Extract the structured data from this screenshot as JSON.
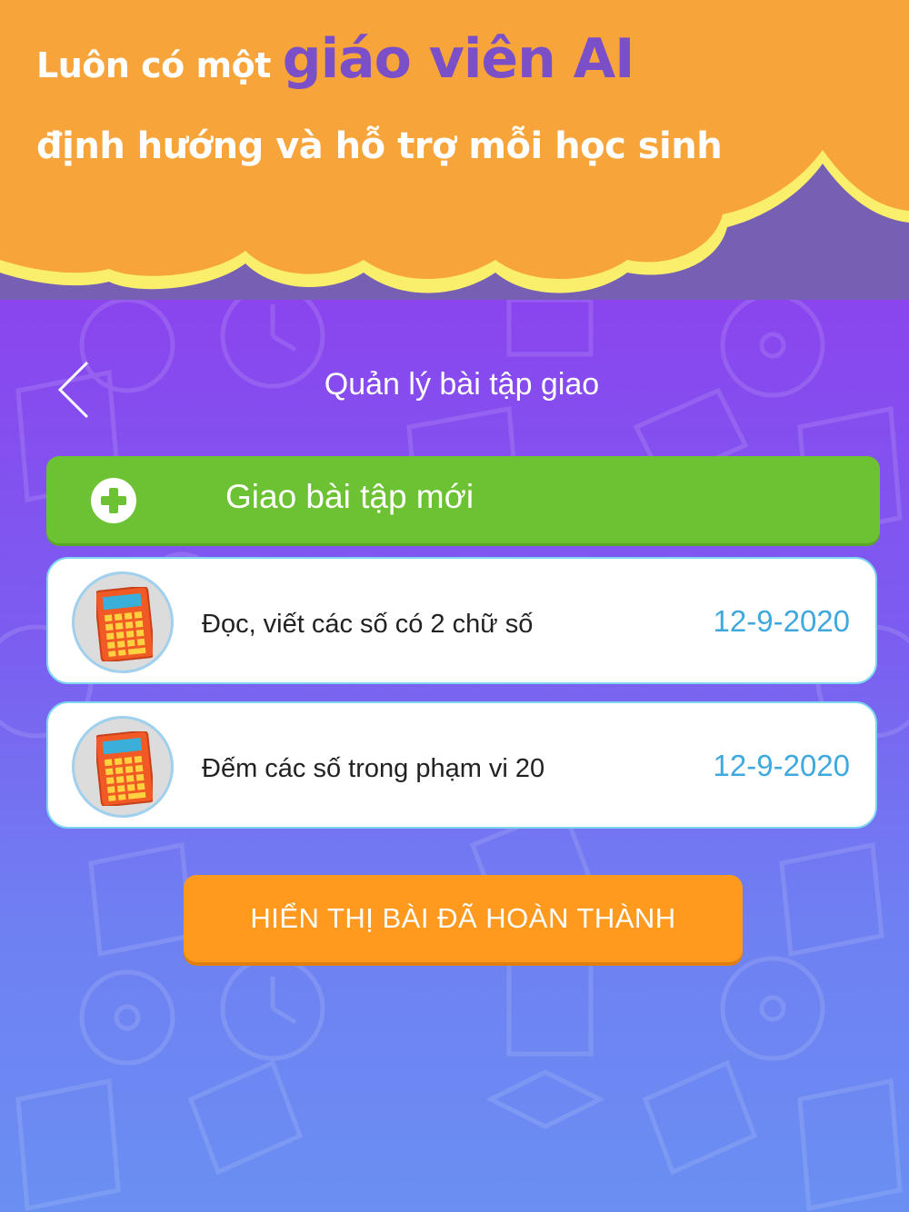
{
  "banner": {
    "line1_prefix": "Luôn có một",
    "line1_accent": "giáo viên AI",
    "line2": "định hướng và hỗ trợ mỗi học sinh"
  },
  "nav": {
    "back_icon": "chevron-left-icon",
    "title": "Quản lý bài tập giao"
  },
  "add_button": {
    "icon": "plus-circle-icon",
    "label": "Giao bài tập mới"
  },
  "assignments": [
    {
      "icon": "calculator-icon",
      "title": "Đọc, viết các số có 2 chữ số",
      "date": "12-9-2020"
    },
    {
      "icon": "calculator-icon",
      "title": "Đếm các số trong phạm vi 20",
      "date": "12-9-2020"
    }
  ],
  "show_completed_button": {
    "label": "HIỂN THỊ BÀI ĐÃ HOÀN THÀNH"
  },
  "colors": {
    "banner_orange": "#f7a53b",
    "banner_accent": "#7a4fc8",
    "background_top": "#8a45ee",
    "background_bottom": "#6a8ff2",
    "add_green": "#6cc233",
    "date_blue": "#3fa8df",
    "button_orange": "#ff9a1f"
  }
}
